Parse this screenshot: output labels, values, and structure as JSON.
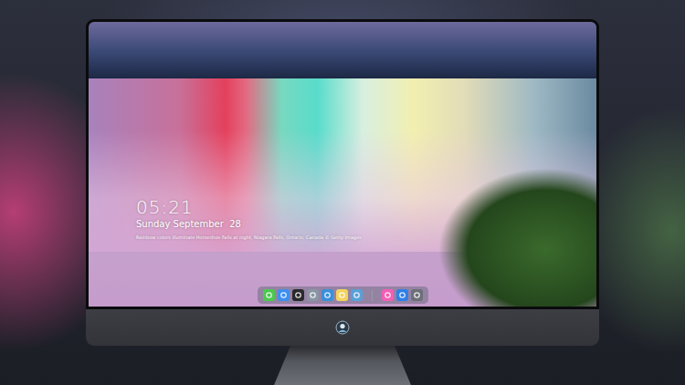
{
  "screen": {
    "time": "05:21",
    "date": "Sunday September  28",
    "caption": "Rainbow colors illuminate Horseshoe Falls at night, Niagara Falls, Ontario, Canada © Getty Images"
  },
  "dock": {
    "items": [
      {
        "kind": "app",
        "color": "#4cc94f"
      },
      {
        "kind": "app",
        "color": "#3d8ff0"
      },
      {
        "kind": "app",
        "color": "#2a2a2e"
      },
      {
        "kind": "app",
        "color": "#8a95a5"
      },
      {
        "kind": "app",
        "color": "#3b8fd9"
      },
      {
        "kind": "app",
        "color": "#f4d35e"
      },
      {
        "kind": "app",
        "color": "#5aa0d8"
      },
      {
        "kind": "separator",
        "color": "#9a9aa6"
      },
      {
        "kind": "app",
        "color": "#f25fb4"
      },
      {
        "kind": "app",
        "color": "#2f7fe8"
      },
      {
        "kind": "app",
        "color": "#6d6f78"
      }
    ]
  }
}
